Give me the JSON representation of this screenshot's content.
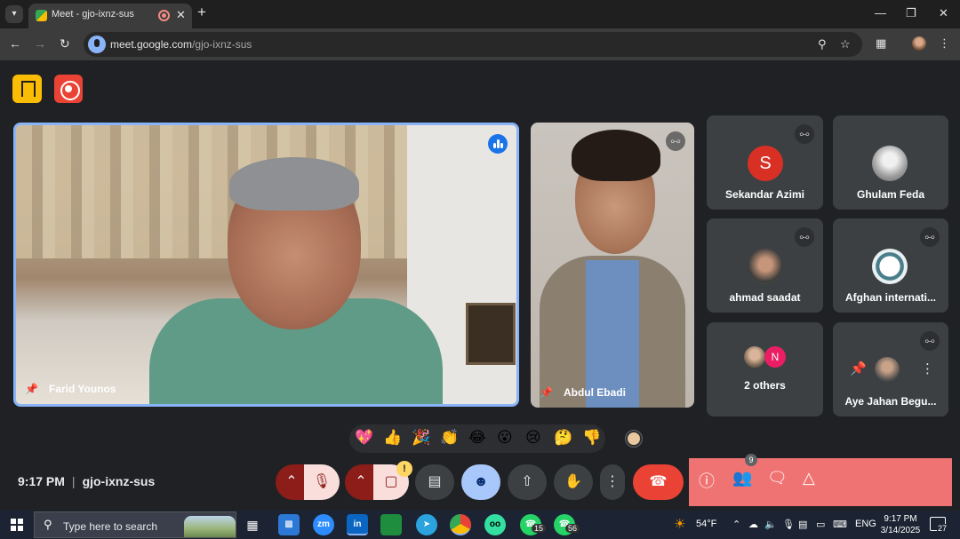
{
  "browser": {
    "tab_title": "Meet - gjo-ixnz-sus",
    "url_host": "meet.google.com",
    "url_path": "/gjo-ixnz-sus"
  },
  "participants": {
    "main": {
      "name": "Farid Younos"
    },
    "second": {
      "name": "Abdul Ebadi"
    },
    "grid": [
      {
        "name": "Sekandar Azimi",
        "avatar_letter": "S",
        "avatar_color": "#d93025"
      },
      {
        "name": "Ghulam Feda"
      },
      {
        "name": "ahmad saadat"
      },
      {
        "name": "Afghan internati..."
      },
      {
        "name": "2 others",
        "avatar_letter": "N",
        "avatar_color": "#e91e63"
      },
      {
        "name": "Aye Jahan Begu..."
      }
    ]
  },
  "reactions": [
    "💖",
    "👍",
    "🎉",
    "👏",
    "😂",
    "😮",
    "😢",
    "🤔",
    "👎"
  ],
  "meeting": {
    "time": "9:17 PM",
    "code": "gjo-ixnz-sus",
    "people_count": "9"
  },
  "taskbar": {
    "search_placeholder": "Type here to search",
    "apps": [
      {
        "icon": "task-view-icon",
        "label": ""
      },
      {
        "icon": "store-icon",
        "label": ""
      },
      {
        "icon": "zoom-icon",
        "label": "zm"
      },
      {
        "icon": "linkedin-icon",
        "label": "in"
      },
      {
        "icon": "classroom-icon",
        "label": ""
      },
      {
        "icon": "telegram-icon",
        "label": ""
      },
      {
        "icon": "chrome-icon",
        "label": ""
      },
      {
        "icon": "tripadvisor-icon",
        "label": ""
      },
      {
        "icon": "whatsapp-icon",
        "label": "",
        "badge": "15"
      },
      {
        "icon": "whatsapp-icon",
        "label": "",
        "badge": "56"
      }
    ],
    "weather": "54°F",
    "language": "ENG",
    "time": "9:17 PM",
    "date": "3/14/2025",
    "notifications": "27"
  }
}
